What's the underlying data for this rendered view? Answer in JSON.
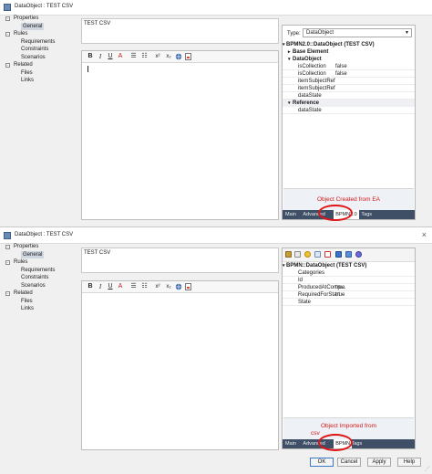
{
  "dialogs": [
    {
      "window_title": "DataObject : TEST CSV",
      "tree": [
        {
          "label": "Properties",
          "expander": "−",
          "level": 0,
          "selected": false
        },
        {
          "label": "General",
          "level": 1,
          "selected": true
        },
        {
          "label": "Rules",
          "expander": "−",
          "level": 0,
          "selected": false
        },
        {
          "label": "Requirements",
          "level": 1,
          "selected": false
        },
        {
          "label": "Constraints",
          "level": 1,
          "selected": false
        },
        {
          "label": "Scenarios",
          "level": 1,
          "selected": false
        },
        {
          "label": "Related",
          "expander": "−",
          "level": 0,
          "selected": false
        },
        {
          "label": "Files",
          "level": 1,
          "selected": false
        },
        {
          "label": "Links",
          "level": 1,
          "selected": false
        }
      ],
      "name_value": "TEST CSV",
      "type_label": "Type:",
      "type_value": "DataObject",
      "grid": [
        {
          "kind": "hdr",
          "name": "BPMN2.0::DataObject (TEST CSV)",
          "expander": "▾"
        },
        {
          "kind": "hdr",
          "name": "Base Element",
          "expander": "▸"
        },
        {
          "kind": "hdr",
          "name": "DataObject",
          "expander": "▾"
        },
        {
          "kind": "prop",
          "name": "isCollection",
          "value": "false"
        },
        {
          "kind": "prop",
          "name": "isCollection",
          "value": "false"
        },
        {
          "kind": "prop",
          "name": "itemSubjectRef",
          "value": ""
        },
        {
          "kind": "prop",
          "name": "itemSubjectRef",
          "value": ""
        },
        {
          "kind": "prop",
          "name": "dataState",
          "value": ""
        },
        {
          "kind": "sec",
          "name": "Reference",
          "expander": "▾"
        },
        {
          "kind": "prop",
          "name": "dataState",
          "value": ""
        }
      ],
      "annotation": "Object Created from EA",
      "tabs": [
        "Main",
        "Advanced",
        "BPMN2.0",
        "Tags"
      ],
      "active_tab": "BPMN2.0"
    },
    {
      "window_title": "DataObject : TEST CSV",
      "tree": [
        {
          "label": "Properties",
          "expander": "−",
          "level": 0,
          "selected": false
        },
        {
          "label": "General",
          "level": 1,
          "selected": true
        },
        {
          "label": "Rules",
          "expander": "−",
          "level": 0,
          "selected": false
        },
        {
          "label": "Requirements",
          "level": 1,
          "selected": false
        },
        {
          "label": "Constraints",
          "level": 1,
          "selected": false
        },
        {
          "label": "Scenarios",
          "level": 1,
          "selected": false
        },
        {
          "label": "Related",
          "expander": "−",
          "level": 0,
          "selected": false
        },
        {
          "label": "Files",
          "level": 1,
          "selected": false
        },
        {
          "label": "Links",
          "level": 1,
          "selected": false
        }
      ],
      "name_value": "TEST CSV",
      "grid": [
        {
          "kind": "hdr",
          "name": "BPMN::DataObject (TEST CSV)",
          "expander": "▾"
        },
        {
          "kind": "prop",
          "name": "Categories",
          "value": ""
        },
        {
          "kind": "prop",
          "name": "Id",
          "value": ""
        },
        {
          "kind": "prop",
          "name": "ProducedAtComp...",
          "value": "true"
        },
        {
          "kind": "prop",
          "name": "RequiredForStart",
          "value": "true"
        },
        {
          "kind": "prop",
          "name": "State",
          "value": ""
        }
      ],
      "annotation_lines": [
        "Object Imported from",
        "csv"
      ],
      "tabs": [
        "Main",
        "Advanced",
        "BPMN",
        "Tags"
      ],
      "active_tab": "BPMN",
      "buttons": {
        "ok": "OK",
        "cancel": "Cancel",
        "apply": "Apply",
        "help": "Help"
      }
    }
  ],
  "format_toolbar": {
    "bold": "B",
    "italic": "I",
    "underline": "U",
    "font_color": "A",
    "bullets": "☰",
    "numbering": "☷",
    "superscript": "x²",
    "subscript": "x₂"
  },
  "colors": {
    "annotation_red": "#d11a1a",
    "tabbar_bg": "#3f4f66",
    "selected_tree_bg": "#cfd6e0",
    "ellipse_red": "#e01515"
  }
}
